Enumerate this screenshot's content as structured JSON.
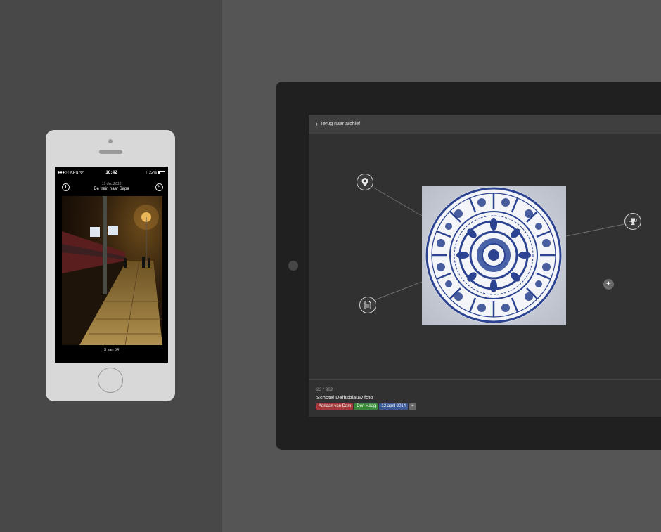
{
  "phone": {
    "status": {
      "carrier": "●●●○○ KPN",
      "time": "10:42",
      "battery": "22%"
    },
    "date": "19 dec 2010",
    "title": "De trein naar Sapa",
    "counter": "3 van 54",
    "icons": {
      "info": "info-icon",
      "close": "close-icon",
      "wifi": "wifi-icon",
      "bluetooth": "bluetooth-icon"
    }
  },
  "tablet": {
    "back_label": "Terug naar archief",
    "item_count": "23 / 962",
    "item_title": "Schotel Delftsblauw foto",
    "tags": [
      {
        "label": "Adriaan van Dam",
        "color": "#a43a3a"
      },
      {
        "label": "Den Haag",
        "color": "#3a8a3a"
      },
      {
        "label": "12 april 2014",
        "color": "#3b5a95"
      }
    ],
    "add_tag_label": "+",
    "add_button_label": "+",
    "nodes": [
      "location-pin-icon",
      "document-icon",
      "trophy-icon"
    ]
  },
  "colors": {
    "left_background": "#484848",
    "right_background": "#555555",
    "tablet_bezel": "#202020",
    "tablet_screen": "#313131",
    "plate_blue": "#2b4390"
  }
}
